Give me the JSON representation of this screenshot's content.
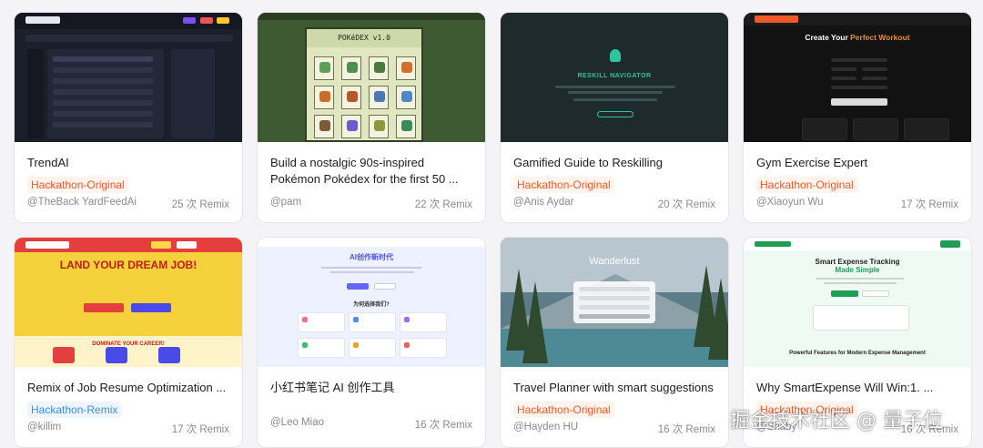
{
  "cards": [
    {
      "title": "TrendAI",
      "tag": "Hackathon-Original",
      "author": "@TheBack YardFeedAi",
      "remix": "25 次 Remix",
      "thumb": {
        "brand": "TrendAI"
      }
    },
    {
      "title": "Build a nostalgic 90s-inspired Pokémon Pokédex for the first 50 ...",
      "tag": "",
      "author": "@pam",
      "remix": "22 次 Remix",
      "thumb": {
        "header": "POKéDEX v1.0"
      }
    },
    {
      "title": "Gamified Guide to Reskilling",
      "tag": "Hackathon-Original",
      "author": "@Anis Aydar",
      "remix": "20 次 Remix",
      "thumb": {
        "header": "RESKILL NAVIGATOR"
      }
    },
    {
      "title": "Gym Exercise Expert",
      "tag": "Hackathon-Original",
      "author": "@Xiaoyun Wu",
      "remix": "17 次 Remix",
      "thumb": {
        "header_plain": "Create Your ",
        "header_accent": "Perfect Workout"
      }
    },
    {
      "title": "Remix of Job Resume Optimization ...",
      "tag": "Hackathon-Remix",
      "author": "@killim",
      "remix": "17 次 Remix",
      "thumb": {
        "headline": "LAND YOUR DREAM JOB!",
        "band": "DOMINATE YOUR CAREER!"
      }
    },
    {
      "title": "小红书笔记 AI 创作工具",
      "tag": "",
      "author": "@Leo Miao",
      "remix": "16 次 Remix",
      "thumb": {
        "header": "AI创作新时代",
        "section": "为何选择我们?"
      }
    },
    {
      "title": "Travel Planner with smart suggestions",
      "tag": "Hackathon-Original",
      "author": "@Hayden HU",
      "remix": "16 次 Remix",
      "thumb": {
        "header": "Wanderlust"
      }
    },
    {
      "title": "Why SmartExpense Will Win:1. ...",
      "tag": "Hackathon-Original",
      "author": "@Shaby",
      "remix": "16 次 Remix",
      "thumb": {
        "header": "Smart Expense Tracking",
        "accent": "Made Simple",
        "footer": "Powerful Features for Modern Expense Management"
      }
    }
  ],
  "watermark": "掘金技术社区 @ 量子位",
  "colors": {
    "tag_original": "#f05a28",
    "tag_remix": "#3a8ee6"
  }
}
